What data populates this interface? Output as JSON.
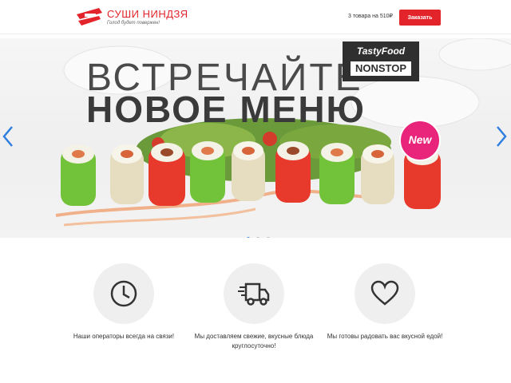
{
  "header": {
    "logo_title": "СУШИ НИНДЗЯ",
    "logo_subtitle": "Голод будет повержен!",
    "cart_info": "3 товара на 510₽",
    "order_button": "Заказать"
  },
  "hero": {
    "line1": "ВСТРЕЧАЙТЕ",
    "line2": "НОВОЕ МЕНЮ",
    "brand_top": "TastyFood",
    "brand_bottom": "NONSTOP",
    "badge": "New",
    "slides": 3,
    "active_slide": 1
  },
  "features": [
    {
      "icon": "clock-icon",
      "text": "Наши операторы всегда на связи!"
    },
    {
      "icon": "truck-icon",
      "text": "Мы доставляем свежие, вкусные блюда круглосуточно!"
    },
    {
      "icon": "heart-icon",
      "text": "Мы готовы радовать вас вкусной едой!"
    }
  ],
  "colors": {
    "accent": "#e3242b",
    "badge": "#e8257a",
    "arrow": "#2f7fe0",
    "active_dot": "#3a8ee6"
  }
}
